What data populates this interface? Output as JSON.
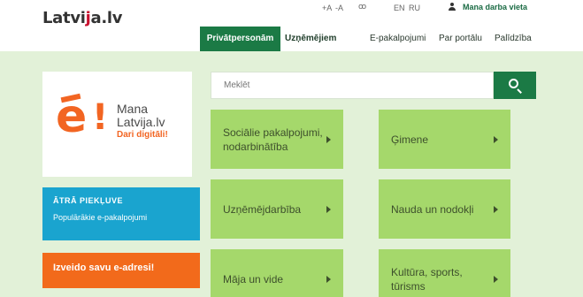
{
  "header": {
    "logo": {
      "prefix": "Latvi",
      "mark": "j",
      "suffix": "a.lv"
    },
    "font_increase": "+A",
    "font_decrease": "-A",
    "contrast_icon": "ꝏ",
    "lang_en": "EN",
    "lang_ru": "RU",
    "user_link": "Mana darba vieta",
    "user_icon": "user-icon"
  },
  "tabs": {
    "private": "Privātpersonām",
    "business": "Uzņēmējiem"
  },
  "nav": {
    "eservices": "E-pakalpojumi",
    "portal": "Par portālu",
    "help": "Palīdzība"
  },
  "promo": {
    "line1": "Mana",
    "line2": "Latvija.lv",
    "line3": "Dari digitāli!",
    "logo_letter": "e",
    "logo_excl": "!"
  },
  "quick_access": {
    "title": "ĀTRĀ PIEKĻUVE",
    "subtitle": "Populārākie e-pakalpojumi"
  },
  "eaddress": {
    "label": "Izveido savu e-adresi!"
  },
  "search": {
    "placeholder": "Meklēt"
  },
  "tiles": [
    {
      "label": "Sociālie pakalpojumi, nodarbinātība"
    },
    {
      "label": "Ģimene"
    },
    {
      "label": "Uzņēmējdarbība"
    },
    {
      "label": "Nauda un nodokļi"
    },
    {
      "label": "Māja un vide"
    },
    {
      "label": "Kultūra, sports, tūrisms"
    }
  ],
  "colors": {
    "brand_green": "#1b7a45",
    "tile_green": "#a5d86b",
    "background_green": "#e2f1d8",
    "quick_blue": "#1aa4cf",
    "eaddress_orange": "#f26a1b",
    "logo_red": "#c8102e"
  }
}
